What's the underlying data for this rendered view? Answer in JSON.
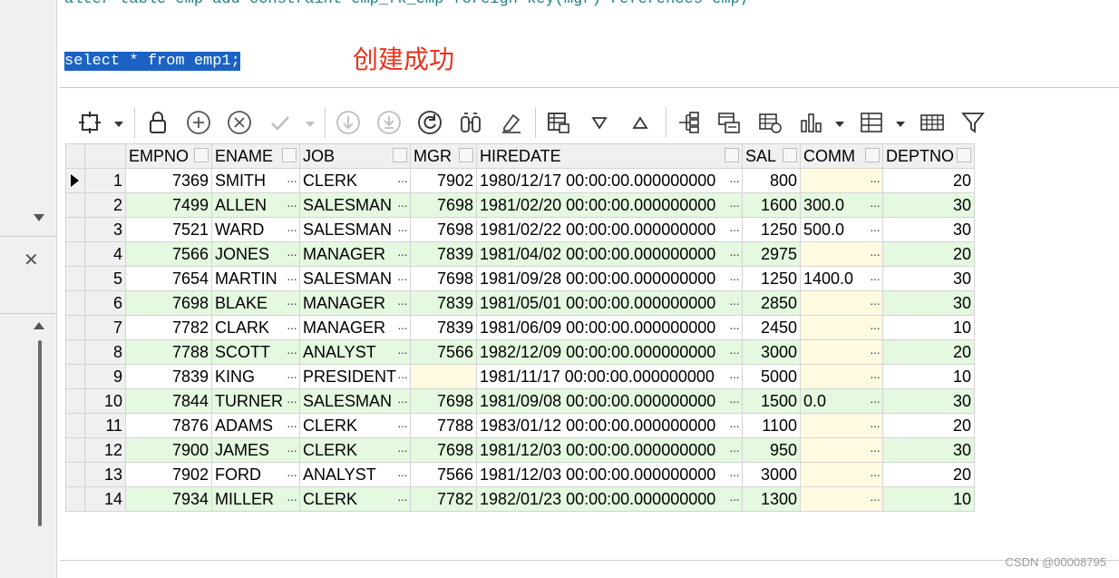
{
  "editor": {
    "line1": "alter table emp add constraint emp_fk_emp foreign key(mgr) references emp;",
    "line2": "select * from emp1;",
    "annotation": "创建成功"
  },
  "icons": [
    "layout-icon",
    "lock-icon",
    "add-record-icon",
    "delete-record-icon",
    "post-edits-icon",
    "cancel-edits-icon",
    "fetch-next-icon",
    "fetch-last-icon",
    "refresh-icon",
    "query-by-example-icon",
    "clear-icon",
    "single-record-icon",
    "sort-desc-icon",
    "sort-asc-icon",
    "tree-view-icon",
    "export-icon",
    "import-icon",
    "chart-icon",
    "crosstab-icon",
    "table-view-icon",
    "filter-icon"
  ],
  "grid": {
    "columns": [
      "EMPNO",
      "ENAME",
      "JOB",
      "MGR",
      "HIREDATE",
      "SAL",
      "COMM",
      "DEPTNO"
    ],
    "rows": [
      [
        "1",
        "7369",
        "SMITH",
        "CLERK",
        "7902",
        "1980/12/17 00:00:00.000000000",
        "800",
        "",
        "20"
      ],
      [
        "2",
        "7499",
        "ALLEN",
        "SALESMAN",
        "7698",
        "1981/02/20 00:00:00.000000000",
        "1600",
        "300.0",
        "30"
      ],
      [
        "3",
        "7521",
        "WARD",
        "SALESMAN",
        "7698",
        "1981/02/22 00:00:00.000000000",
        "1250",
        "500.0",
        "30"
      ],
      [
        "4",
        "7566",
        "JONES",
        "MANAGER",
        "7839",
        "1981/04/02 00:00:00.000000000",
        "2975",
        "",
        "20"
      ],
      [
        "5",
        "7654",
        "MARTIN",
        "SALESMAN",
        "7698",
        "1981/09/28 00:00:00.000000000",
        "1250",
        "1400.0",
        "30"
      ],
      [
        "6",
        "7698",
        "BLAKE",
        "MANAGER",
        "7839",
        "1981/05/01 00:00:00.000000000",
        "2850",
        "",
        "30"
      ],
      [
        "7",
        "7782",
        "CLARK",
        "MANAGER",
        "7839",
        "1981/06/09 00:00:00.000000000",
        "2450",
        "",
        "10"
      ],
      [
        "8",
        "7788",
        "SCOTT",
        "ANALYST",
        "7566",
        "1982/12/09 00:00:00.000000000",
        "3000",
        "",
        "20"
      ],
      [
        "9",
        "7839",
        "KING",
        "PRESIDENT",
        "",
        "1981/11/17 00:00:00.000000000",
        "5000",
        "",
        "10"
      ],
      [
        "10",
        "7844",
        "TURNER",
        "SALESMAN",
        "7698",
        "1981/09/08 00:00:00.000000000",
        "1500",
        "0.0",
        "30"
      ],
      [
        "11",
        "7876",
        "ADAMS",
        "CLERK",
        "7788",
        "1983/01/12 00:00:00.000000000",
        "1100",
        "",
        "20"
      ],
      [
        "12",
        "7900",
        "JAMES",
        "CLERK",
        "7698",
        "1981/12/03 00:00:00.000000000",
        "950",
        "",
        "30"
      ],
      [
        "13",
        "7902",
        "FORD",
        "ANALYST",
        "7566",
        "1981/12/03 00:00:00.000000000",
        "3000",
        "",
        "20"
      ],
      [
        "14",
        "7934",
        "MILLER",
        "CLERK",
        "7782",
        "1982/01/23 00:00:00.000000000",
        "1300",
        "",
        "10"
      ]
    ]
  },
  "dots": "···",
  "watermark": "CSDN @00008795",
  "colors": {
    "selection": "#1b62c4",
    "annotation": "#e8321e",
    "even_row": "#e4f9e0",
    "null_cell": "#fffae0"
  }
}
